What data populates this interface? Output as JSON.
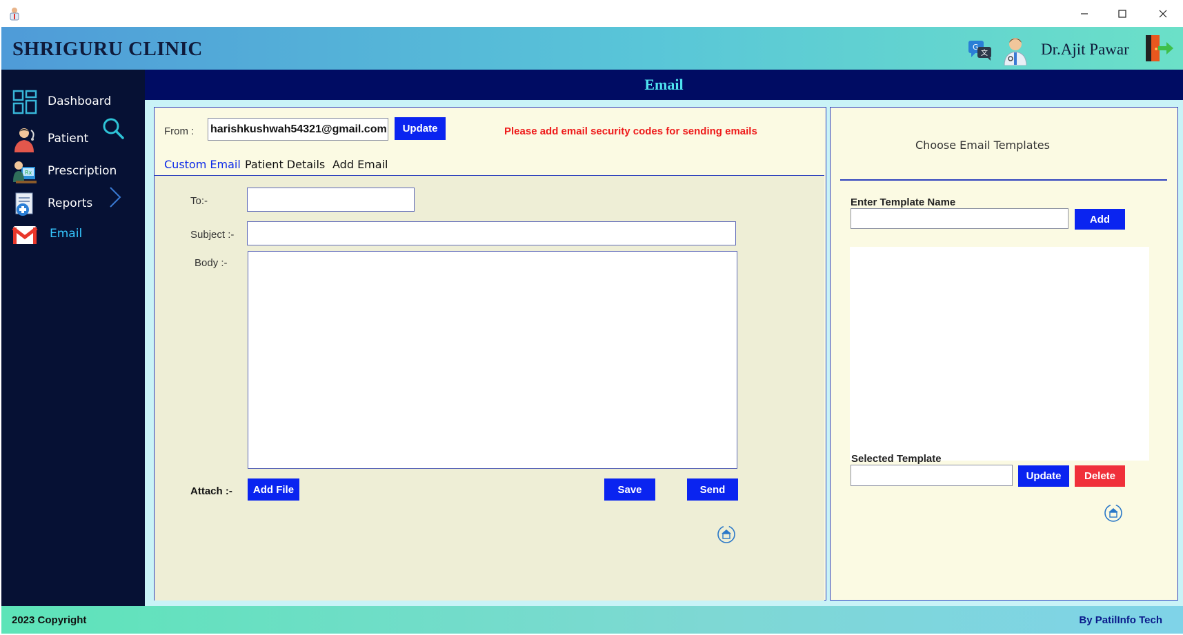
{
  "header": {
    "clinic_name": "SHRIGURU CLINIC",
    "doctor_name": "Dr.Ajit Pawar"
  },
  "sidebar": {
    "items": [
      {
        "label": "Dashboard"
      },
      {
        "label": "Patient"
      },
      {
        "label": "Prescription"
      },
      {
        "label": "Reports"
      },
      {
        "label": "Email"
      }
    ]
  },
  "page": {
    "title": "Email"
  },
  "email": {
    "from_label": "From :",
    "from_value": "harishkushwah54321@gmail.com",
    "update_label": "Update",
    "warning": "Please add email security codes for sending emails",
    "tabs": [
      {
        "label": "Custom Email"
      },
      {
        "label": "Patient Details"
      },
      {
        "label": "Add Email"
      }
    ],
    "to_label": "To:-",
    "subject_label": "Subject :-",
    "body_label": "Body :-",
    "attach_label": "Attach :-",
    "add_file_label": "Add File",
    "save_label": "Save",
    "send_label": "Send"
  },
  "templates": {
    "title": "Choose Email Templates",
    "name_label": "Enter Template Name",
    "add_label": "Add",
    "selected_label": "Selected Template",
    "update_label": "Update",
    "delete_label": "Delete"
  },
  "footer": {
    "copyright": "2023 Copyright",
    "credit": "By PatilInfo Tech"
  },
  "colors": {
    "sidebar": "#061134",
    "main_header": "#000c63",
    "primary_button": "#0a24f0",
    "danger_button": "#f0303a",
    "warning_text": "#ee1b1b"
  }
}
